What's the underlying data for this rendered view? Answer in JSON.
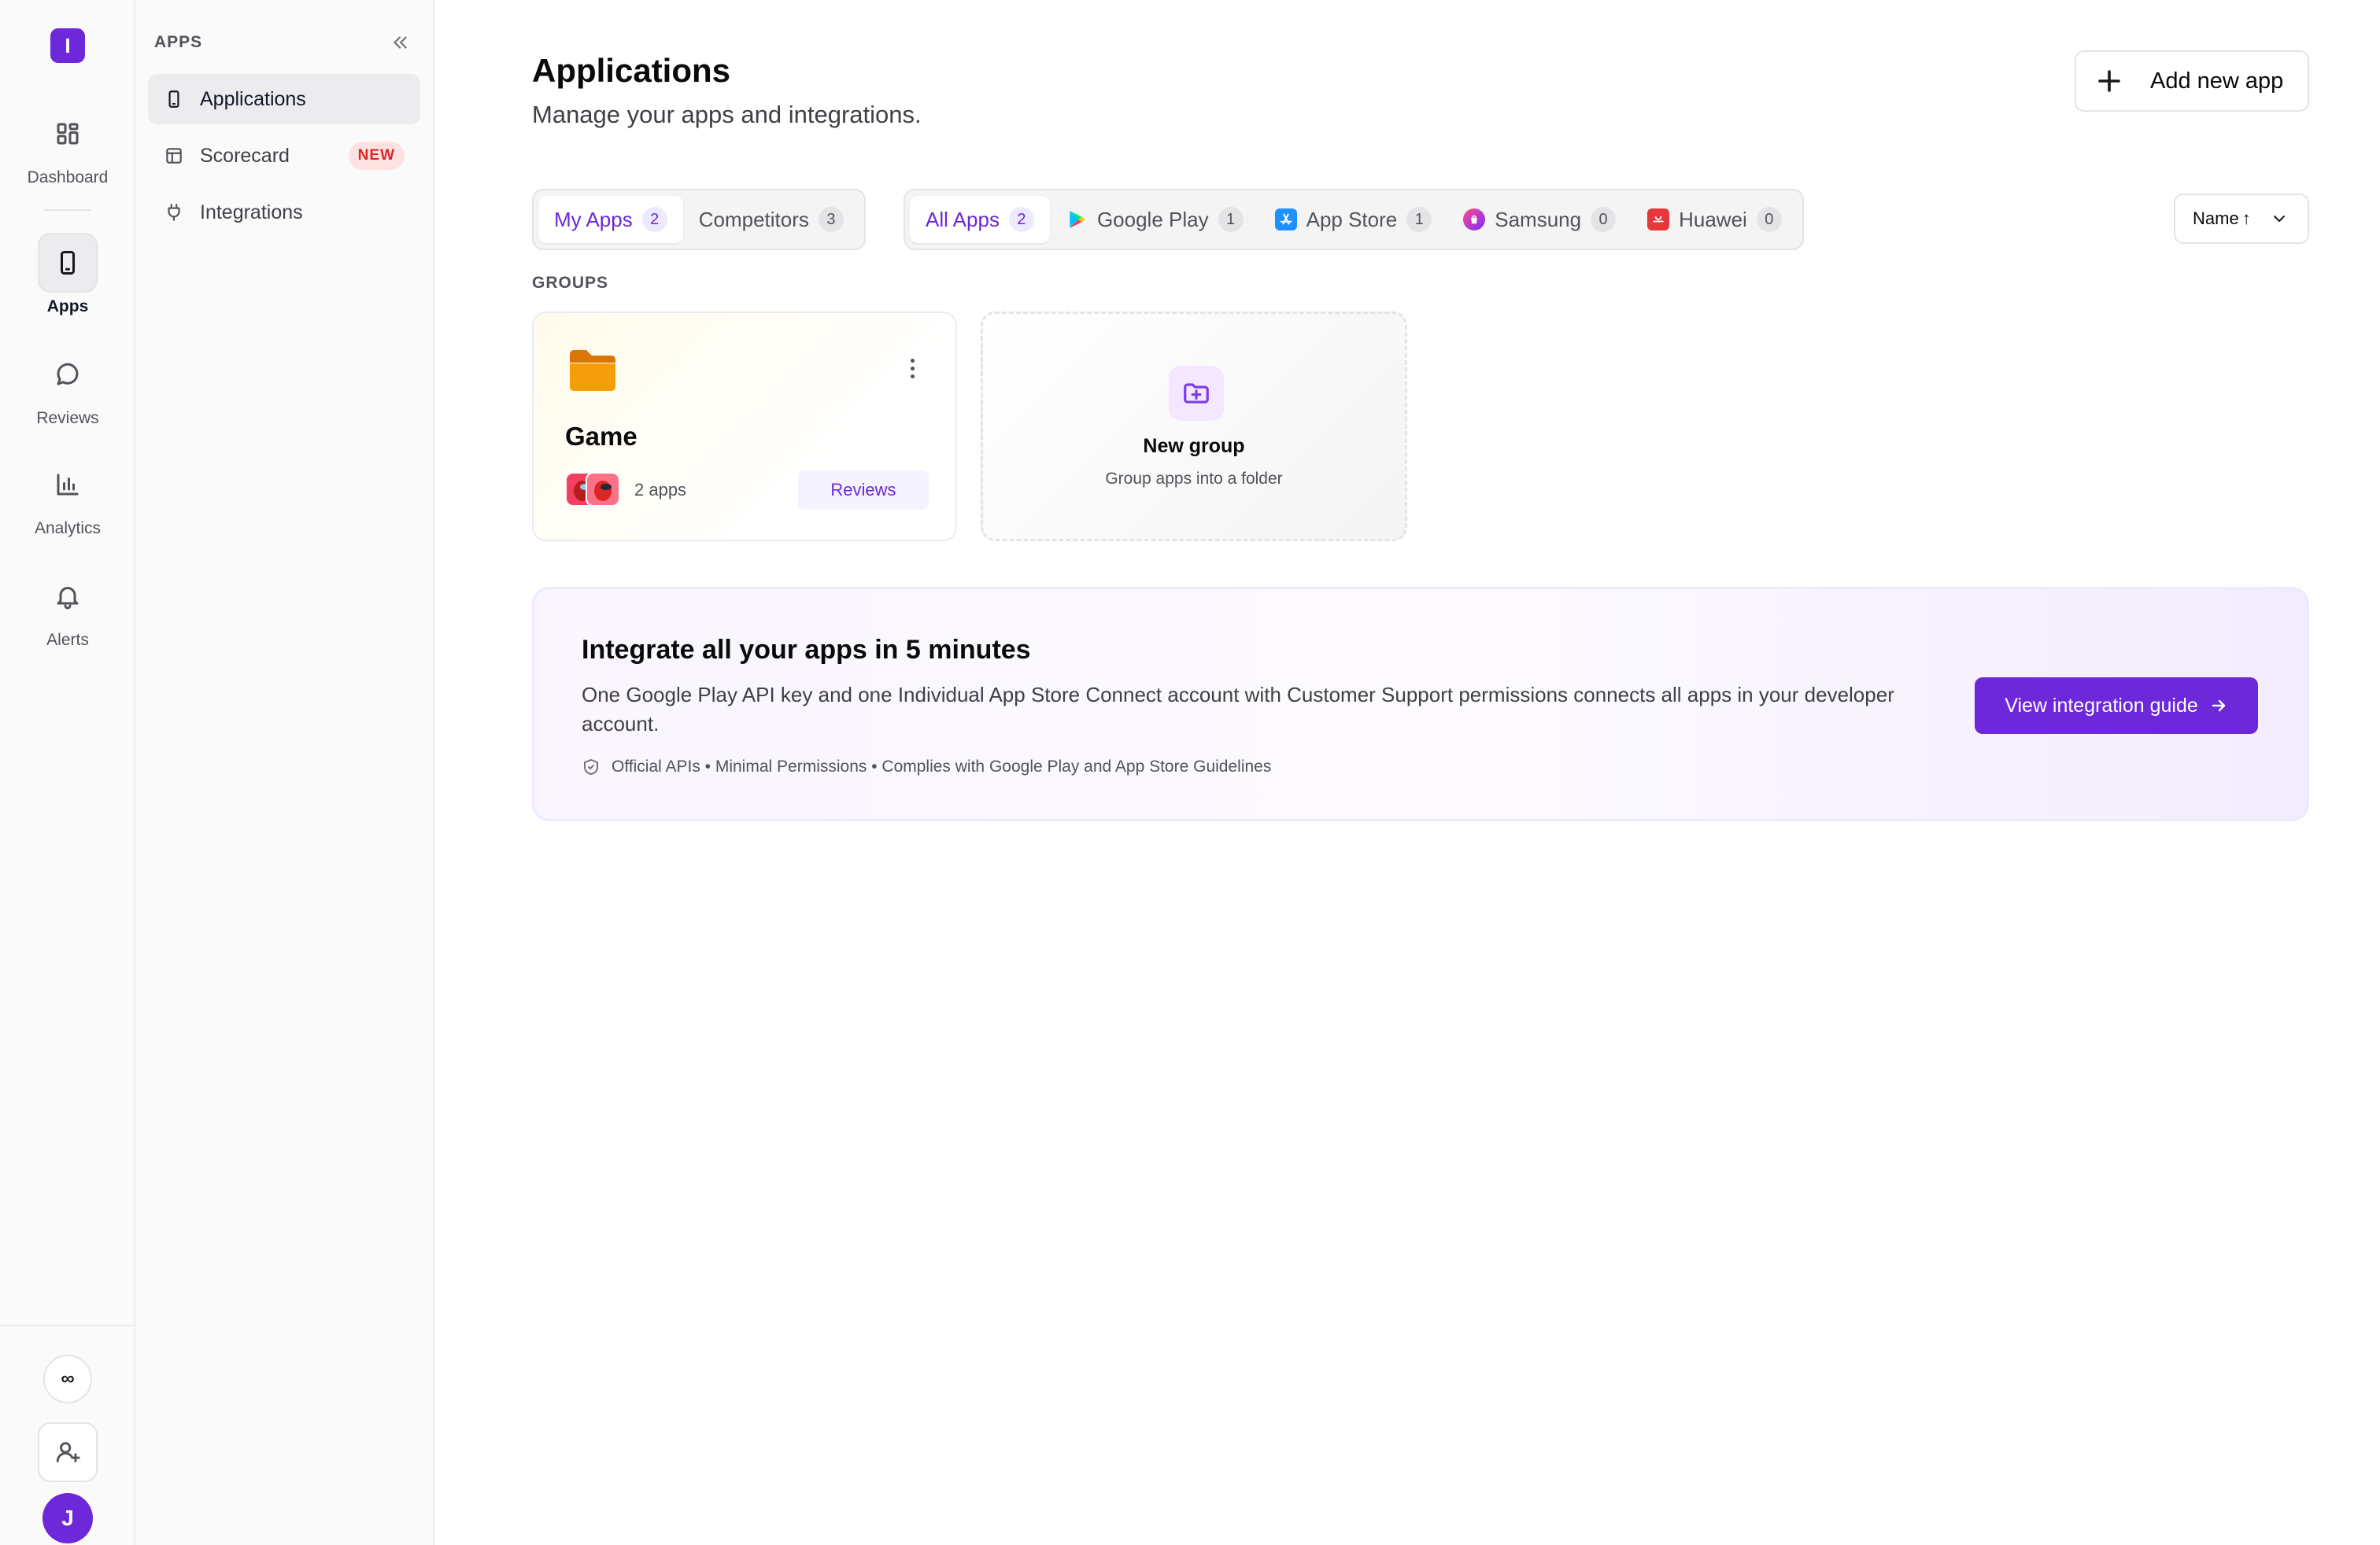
{
  "rail": {
    "logo_letter": "I",
    "items": [
      {
        "label": "Dashboard",
        "icon": "dashboard-icon",
        "active": false
      },
      {
        "label": "Apps",
        "icon": "phone-icon",
        "active": true
      },
      {
        "label": "Reviews",
        "icon": "chat-bubble-icon",
        "active": false
      },
      {
        "label": "Analytics",
        "icon": "bar-chart-icon",
        "active": false
      },
      {
        "label": "Alerts",
        "icon": "bell-icon",
        "active": false
      }
    ],
    "infinity_glyph": "∞",
    "avatar_letter": "J"
  },
  "sidebar": {
    "heading": "APPS",
    "items": [
      {
        "label": "Applications",
        "icon": "phone-icon",
        "active": true
      },
      {
        "label": "Scorecard",
        "icon": "table-icon",
        "badge": "NEW"
      },
      {
        "label": "Integrations",
        "icon": "plug-icon"
      }
    ]
  },
  "header": {
    "title": "Applications",
    "subtitle": "Manage your apps and integrations.",
    "add_button_label": "Add new app"
  },
  "ownership_tabs": [
    {
      "label": "My Apps",
      "count": "2",
      "active": true
    },
    {
      "label": "Competitors",
      "count": "3",
      "active": false
    }
  ],
  "store_tabs": [
    {
      "label": "All Apps",
      "count": "2",
      "active": true
    },
    {
      "label": "Google Play",
      "count": "1",
      "icon": "google-play-icon"
    },
    {
      "label": "App Store",
      "count": "1",
      "icon": "app-store-icon"
    },
    {
      "label": "Samsung",
      "count": "0",
      "icon": "samsung-galaxy-store-icon"
    },
    {
      "label": "Huawei",
      "count": "0",
      "icon": "huawei-appgallery-icon"
    }
  ],
  "sort": {
    "label": "Name",
    "direction_glyph": "↑"
  },
  "groups": {
    "heading": "GROUPS",
    "cards": [
      {
        "title": "Game",
        "apps_count": "2 apps",
        "action_label": "Reviews"
      }
    ],
    "new_group": {
      "title": "New group",
      "subtitle": "Group apps into a folder"
    }
  },
  "banner": {
    "title": "Integrate all your apps in 5 minutes",
    "description": "One Google Play API key and one Individual App Store Connect account with Customer Support permissions connects all apps in your developer account.",
    "footnote": "Official APIs • Minimal Permissions • Complies with Google Play and App Store Guidelines",
    "button_label": "View integration guide"
  },
  "colors": {
    "accent": "#6d28d9",
    "badge_red": "#dc2626",
    "folder": "#f59e0b"
  }
}
